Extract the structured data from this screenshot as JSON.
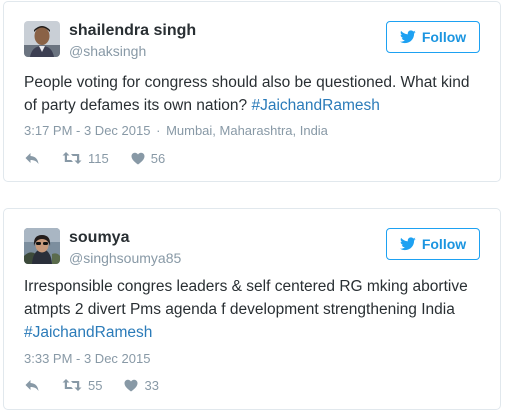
{
  "tweets": [
    {
      "name": "shailendra singh",
      "handle": "@shaksingh",
      "follow_label": "Follow",
      "text_before": "People voting for congress should also be questioned. What kind of party defames its own nation? ",
      "hashtag": "#JaichandRamesh",
      "text_after": "",
      "time": "3:17 PM - 3 Dec 2015",
      "separator": "·",
      "location": "Mumbai, Maharashtra, India",
      "retweets": "115",
      "likes": "56",
      "reply_icon": "reply-icon",
      "retweet_icon": "retweet-icon",
      "like_icon": "heart-icon"
    },
    {
      "name": "soumya",
      "handle": "@singhsoumya85",
      "follow_label": "Follow",
      "text_before": "Irresponsible congres leaders & self centered RG mking abortive atmpts 2 divert Pms agenda f development strengthening India ",
      "hashtag": "#JaichandRamesh",
      "text_after": "",
      "time": "3:33 PM - 3 Dec 2015",
      "retweets": "55",
      "likes": "33",
      "reply_icon": "reply-icon",
      "retweet_icon": "retweet-icon",
      "like_icon": "heart-icon"
    }
  ],
  "colors": {
    "brand_blue": "#1da1f2",
    "link_blue": "#2b7bb9",
    "muted_gray": "#8899a6",
    "border": "#e1e8ed",
    "text": "#292f33"
  }
}
